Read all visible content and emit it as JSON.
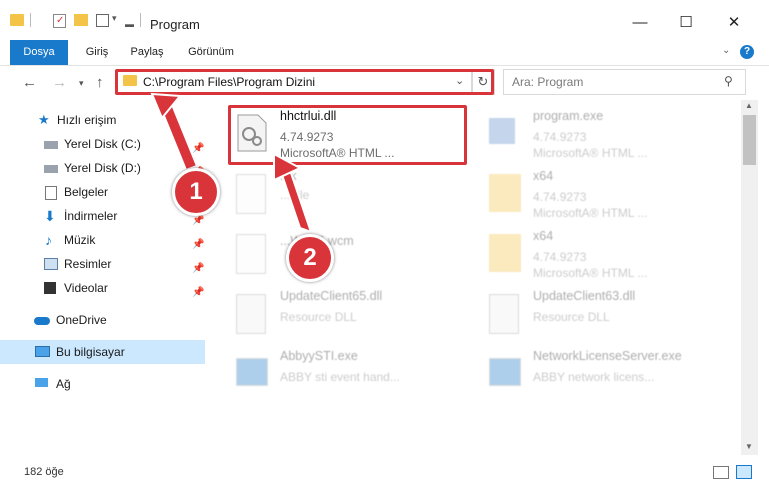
{
  "window": {
    "title": "Program",
    "minimize": "—",
    "maximize": "☐",
    "close": "✕"
  },
  "ribbon": {
    "tabs": [
      "Dosya",
      "Giriş",
      "Paylaş",
      "Görünüm"
    ]
  },
  "address": {
    "path": "C:\\Program Files\\Program Dizini",
    "search_placeholder": "Ara: Program"
  },
  "nav": {
    "items": [
      {
        "label": "Hızlı erişim"
      },
      {
        "label": "Yerel Disk (C:)"
      },
      {
        "label": "Yerel Disk (D:)"
      },
      {
        "label": "Belgeler"
      },
      {
        "label": "İndirmeler"
      },
      {
        "label": "Müzik"
      },
      {
        "label": "Resimler"
      },
      {
        "label": "Videolar"
      },
      {
        "label": "OneDrive"
      },
      {
        "label": "Bu bilgisayar"
      },
      {
        "label": "Ağ"
      }
    ]
  },
  "files": [
    {
      "name": "hhctrlui.dll",
      "version": "4.74.9273",
      "desc": "MicrosoftA® HTML ..."
    },
    {
      "name": "program.exe",
      "version": "4.74.9273",
      "desc": "MicrosoftA® HTML ..."
    },
    {
      "name": "...k",
      "version": "",
      "desc": "...File"
    },
    {
      "name": "x64",
      "version": "4.74.9273",
      "desc": "MicrosoftA® HTML ..."
    },
    {
      "name": "...WP15.wcm",
      "version": "",
      "desc": ""
    },
    {
      "name": "x64",
      "version": "4.74.9273",
      "desc": "MicrosoftA® HTML ..."
    },
    {
      "name": "UpdateClient65.dll",
      "version": "",
      "desc": "Resource DLL"
    },
    {
      "name": "UpdateClient63.dll",
      "version": "",
      "desc": "Resource DLL"
    },
    {
      "name": "AbbyySTI.exe",
      "version": "",
      "desc": "ABBY sti event hand..."
    },
    {
      "name": "NetworkLicenseServer.exe",
      "version": "",
      "desc": "ABBY network licens..."
    }
  ],
  "status": {
    "count": "182 öğe"
  },
  "callouts": {
    "one": "1",
    "two": "2"
  },
  "colors": {
    "accent": "#1979ca",
    "highlight": "#d9343a",
    "selected_nav": "#cce8ff"
  }
}
